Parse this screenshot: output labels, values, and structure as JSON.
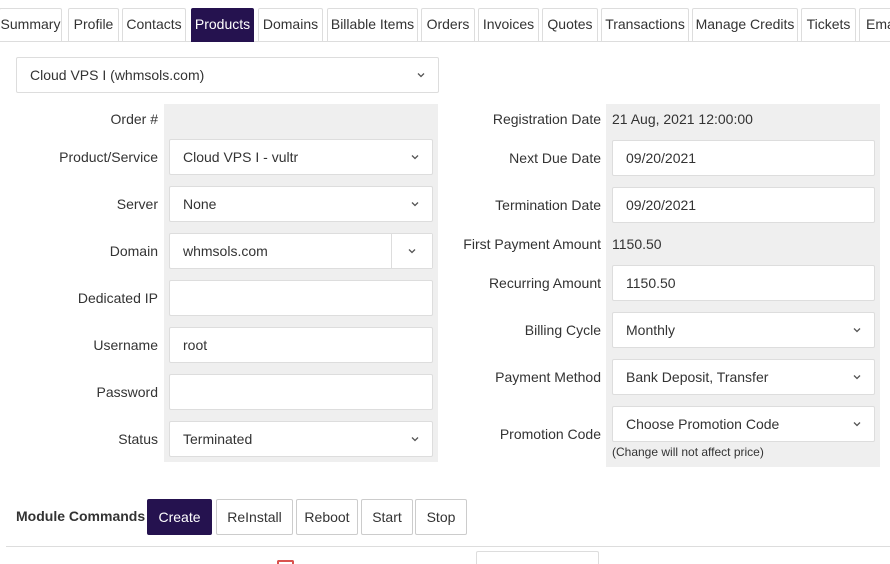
{
  "tabs": [
    {
      "label": "Summary"
    },
    {
      "label": "Profile"
    },
    {
      "label": "Contacts"
    },
    {
      "label": "Products"
    },
    {
      "label": "Domains"
    },
    {
      "label": "Billable Items"
    },
    {
      "label": "Orders"
    },
    {
      "label": "Invoices"
    },
    {
      "label": "Quotes"
    },
    {
      "label": "Transactions"
    },
    {
      "label": "Manage Credits"
    },
    {
      "label": "Tickets"
    },
    {
      "label": "Ema"
    }
  ],
  "product_selector": {
    "value": "Cloud VPS I (whmsols.com)"
  },
  "left": {
    "order_label": "Order #",
    "order_value": "",
    "product_label": "Product/Service",
    "product_value": "Cloud VPS I - vultr",
    "server_label": "Server",
    "server_value": "None",
    "domain_label": "Domain",
    "domain_value": "whmsols.com",
    "dedicated_ip_label": "Dedicated IP",
    "dedicated_ip_value": "",
    "username_label": "Username",
    "username_value": "root",
    "password_label": "Password",
    "password_value": "",
    "status_label": "Status",
    "status_value": "Terminated"
  },
  "right": {
    "reg_date_label": "Registration Date",
    "reg_date_value": "21 Aug, 2021 12:00:00",
    "next_due_label": "Next Due Date",
    "next_due_value": "09/20/2021",
    "termination_label": "Termination Date",
    "termination_value": "09/20/2021",
    "first_payment_label": "First Payment Amount",
    "first_payment_value": "1150.50",
    "recurring_label": "Recurring Amount",
    "recurring_value": "1150.50",
    "billing_cycle_label": "Billing Cycle",
    "billing_cycle_value": "Monthly",
    "payment_method_label": "Payment Method",
    "payment_method_value": "Bank Deposit, Transfer",
    "promo_label": "Promotion Code",
    "promo_value": "Choose Promotion Code",
    "promo_hint": "(Change will not affect price)"
  },
  "module_commands": {
    "label": "Module Commands :",
    "buttons": [
      {
        "label": "Create"
      },
      {
        "label": "ReInstall"
      },
      {
        "label": "Reboot"
      },
      {
        "label": "Start"
      },
      {
        "label": "Stop"
      }
    ]
  },
  "colors": {
    "accent": "#25124f",
    "field_bg": "#efefef",
    "border": "#dddddd"
  }
}
